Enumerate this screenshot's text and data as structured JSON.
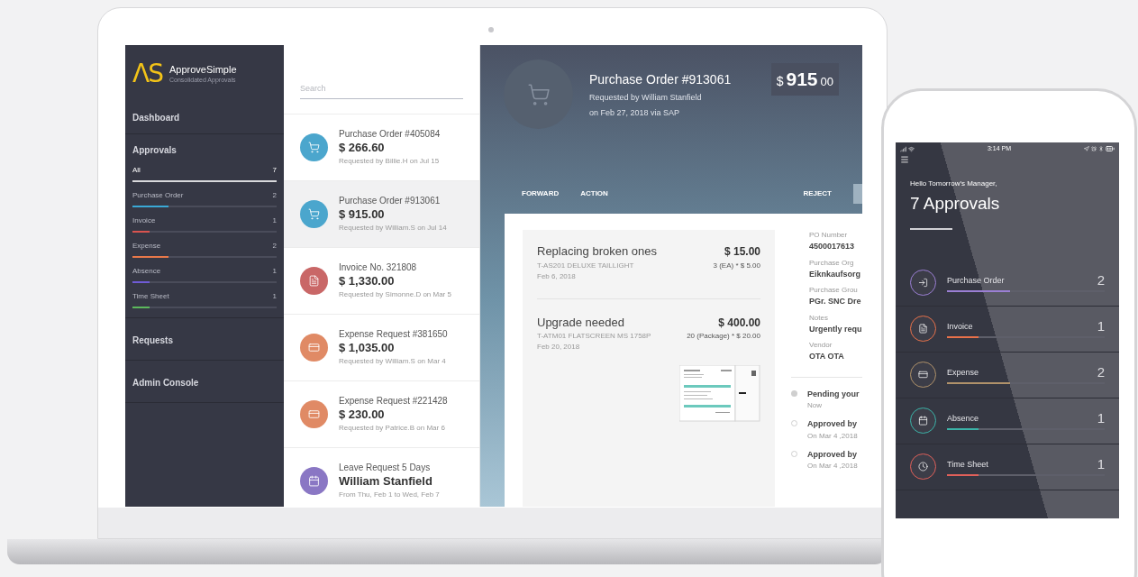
{
  "laptop": {
    "sidebar": {
      "logo": "ΛS",
      "name": "ApproveSimple",
      "tagline": "Consolidated Approvals",
      "dashboard": "Dashboard",
      "approvals": {
        "label": "Approvals",
        "items": [
          {
            "label": "All",
            "count": "7",
            "level": 1,
            "color": "#d9d9dc",
            "selected": true
          },
          {
            "label": "Purchase Order",
            "count": "2",
            "level": 0.25,
            "color": "#3aa9d6",
            "selected": false
          },
          {
            "label": "Invoice",
            "count": "1",
            "level": 0.12,
            "color": "#d9534f",
            "selected": false
          },
          {
            "label": "Expense",
            "count": "2",
            "level": 0.25,
            "color": "#e8784a",
            "selected": false
          },
          {
            "label": "Absence",
            "count": "1",
            "level": 0.12,
            "color": "#6f5bd6",
            "selected": false
          },
          {
            "label": "Time Sheet",
            "count": "1",
            "level": 0.12,
            "color": "#5cb85c",
            "selected": false
          }
        ]
      },
      "links": [
        "Requests",
        "Admin Console"
      ]
    },
    "list": {
      "search_placeholder": "Search",
      "items": [
        {
          "kind": "cart",
          "color": "#4ba6cd",
          "title": "Purchase Order #405084",
          "headline": "$ 266.60",
          "subtitle": "Requested by Billie.H on Jul 15",
          "selected": false
        },
        {
          "kind": "cart",
          "color": "#4ba6cd",
          "title": "Purchase Order #913061",
          "headline": "$ 915.00",
          "subtitle": "Requested by William.S on Jul 14",
          "selected": true
        },
        {
          "kind": "invoice",
          "color": "#c96767",
          "title": "Invoice No. 321808",
          "headline": "$ 1,330.00",
          "subtitle": "Requested by Simonne.D on Mar 5",
          "selected": false
        },
        {
          "kind": "card",
          "color": "#e08a65",
          "title": "Expense Request #381650",
          "headline": "$ 1,035.00",
          "subtitle": "Requested by William.S on Mar 4",
          "selected": false
        },
        {
          "kind": "card",
          "color": "#e08a65",
          "title": "Expense Request #221428",
          "headline": "$ 230.00",
          "subtitle": "Requested by Patrice.B on Mar 6",
          "selected": false
        },
        {
          "kind": "calendar",
          "color": "#8a77c4",
          "title": "Leave Request 5 Days",
          "headline": "William Stanfield",
          "subtitle": "From Thu, Feb 1 to Wed, Feb 7",
          "selected": false
        }
      ]
    },
    "detail": {
      "title": "Purchase Order #913061",
      "requested_by": "Requested by William Stanfield",
      "date_line": "on Feb 27, 2018 via SAP",
      "amount": {
        "currency": "$",
        "whole": "915",
        "cents": "00"
      },
      "actions": [
        "FORWARD",
        "ACTION"
      ],
      "reject": "REJECT",
      "line_items": [
        {
          "title": "Replacing broken ones",
          "code": "T-AS201 DELUXE TAILLIGHT",
          "date": "Feb 6, 2018",
          "total": "$ 15.00",
          "quantity": "3 (EA) * $ 5.00",
          "attachment": false
        },
        {
          "title": "Upgrade needed",
          "code": "T-ATM01 FLATSCREEN MS 1758P",
          "date": "Feb 20, 2018",
          "total": "$ 400.00",
          "quantity": "20 (Package) * $ 20.00",
          "attachment": true
        }
      ],
      "fields": [
        {
          "label": "PO Number",
          "value": "4500017613"
        },
        {
          "label": "Purchase Org",
          "value": "Eiknkaufsorg"
        },
        {
          "label": "Purchase Grou",
          "value": "PGr. SNC Dre"
        },
        {
          "label": "Notes",
          "value": "Urgently requ"
        },
        {
          "label": "Vendor",
          "value": "OTA OTA"
        }
      ],
      "timeline": [
        {
          "title": "Pending your",
          "time": "Now",
          "current": true
        },
        {
          "title": "Approved by",
          "time": "On Mar 4 ,2018",
          "current": false
        },
        {
          "title": "Approved by",
          "time": "On Mar 4 ,2018",
          "current": false
        }
      ]
    }
  },
  "phone": {
    "time": "3:14 PM",
    "greeting": "Hello Tomorrow's Manager,",
    "heading": "7 Approvals",
    "items": [
      {
        "kind": "login",
        "color": "#9b7fd4",
        "label": "Purchase Order",
        "count": "2",
        "level": 0.4
      },
      {
        "kind": "invoice",
        "color": "#e8714a",
        "label": "Invoice",
        "count": "1",
        "level": 0.2
      },
      {
        "kind": "card",
        "color": "#b0926a",
        "label": "Expense",
        "count": "2",
        "level": 0.4
      },
      {
        "kind": "calendar",
        "color": "#3bb3a8",
        "label": "Absence",
        "count": "1",
        "level": 0.2
      },
      {
        "kind": "clock",
        "color": "#e0605a",
        "label": "Time Sheet",
        "count": "1",
        "level": 0.2
      }
    ]
  }
}
